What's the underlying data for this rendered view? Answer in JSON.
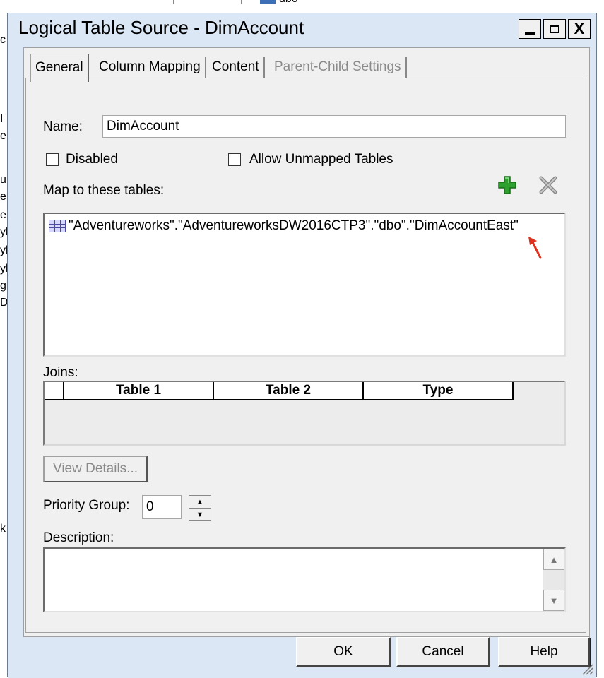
{
  "background": {
    "top_text": "dbo",
    "left_letters": [
      "c",
      "I",
      "e",
      "u",
      "e",
      "e",
      "yl",
      "yl",
      "yl",
      "gl",
      "D",
      "k"
    ]
  },
  "window": {
    "title": "Logical Table Source - DimAccount",
    "controls": {
      "minimize": "_",
      "maximize": "□",
      "close": "X"
    }
  },
  "tabs": [
    {
      "label": "General",
      "active": true,
      "enabled": true
    },
    {
      "label": "Column Mapping",
      "active": false,
      "enabled": true
    },
    {
      "label": "Content",
      "active": false,
      "enabled": true
    },
    {
      "label": "Parent-Child Settings",
      "active": false,
      "enabled": false
    }
  ],
  "general": {
    "name_label": "Name:",
    "name_value": "DimAccount",
    "disabled_label": "Disabled",
    "disabled_checked": false,
    "allow_unmapped_label": "Allow Unmapped Tables",
    "allow_unmapped_checked": false,
    "map_label": "Map to these tables:",
    "mapped_tables": [
      "\"Adventureworks\".\"AdventureworksDW2016CTP3\".\"dbo\".\"DimAccountEast\""
    ],
    "joins_label": "Joins:",
    "joins_columns": [
      "Table 1",
      "Table 2",
      "Type"
    ],
    "view_details_label": "View Details...",
    "priority_label": "Priority Group:",
    "priority_value": "0",
    "description_label": "Description:",
    "description_value": ""
  },
  "buttons": {
    "ok": "OK",
    "cancel": "Cancel",
    "help": "Help"
  },
  "colors": {
    "frame": "#dbe7f4",
    "add_icon": "#2ea02e",
    "remove_icon": "#8a8a8a",
    "arrow": "#e0301e"
  },
  "icons": {
    "add": "plus-icon",
    "remove": "x-icon",
    "table": "table-icon"
  }
}
